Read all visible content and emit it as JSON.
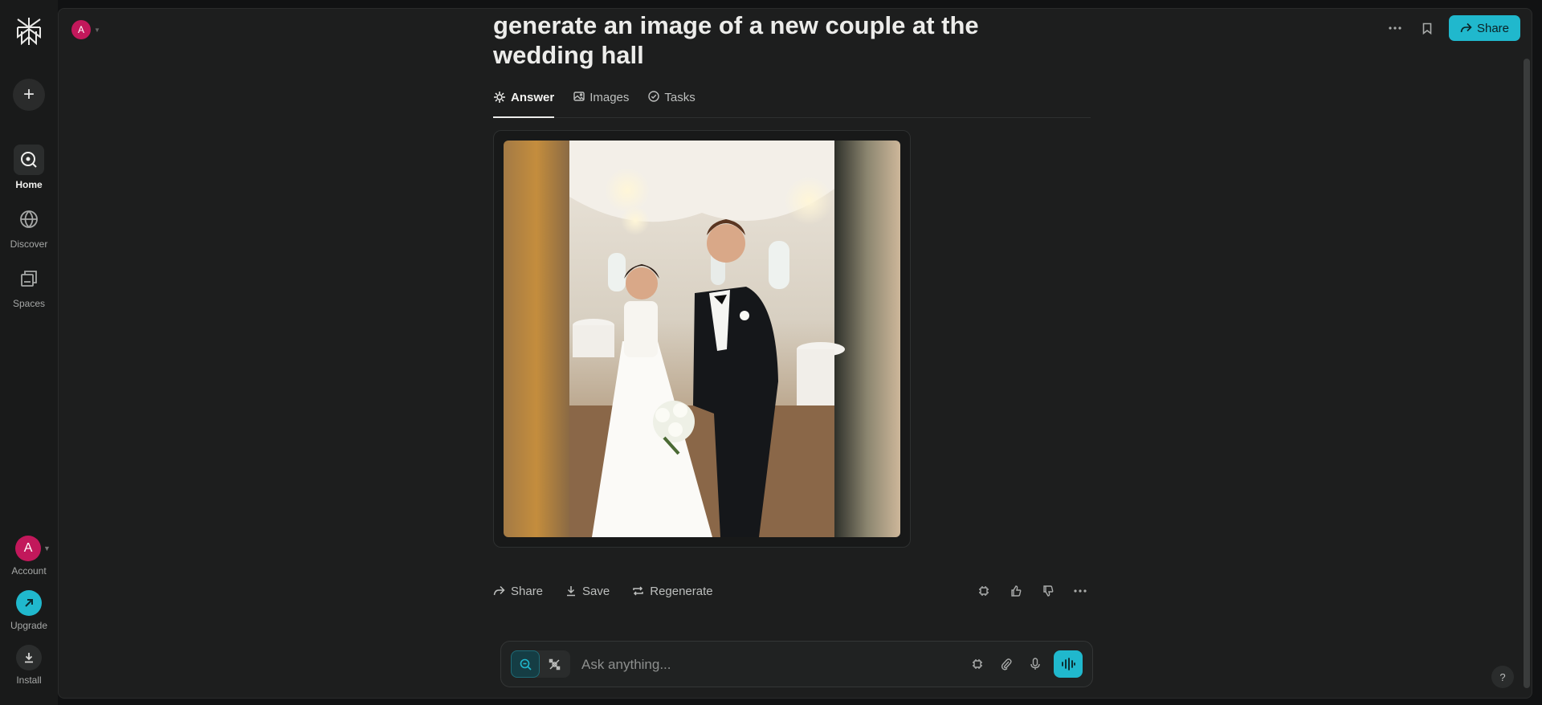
{
  "colors": {
    "accent": "#20b8cd",
    "avatar": "#c2185b"
  },
  "sidebar": {
    "avatar_letter": "A",
    "items": [
      {
        "label": "Home",
        "icon": "search-circle-icon",
        "active": true
      },
      {
        "label": "Discover",
        "icon": "globe-icon",
        "active": false
      },
      {
        "label": "Spaces",
        "icon": "spaces-icon",
        "active": false
      }
    ],
    "account_label": "Account",
    "upgrade_label": "Upgrade",
    "install_label": "Install"
  },
  "header": {
    "avatar_letter": "A",
    "share_label": "Share"
  },
  "thread": {
    "title": "generate an image of a new couple at the wedding hall",
    "tabs": [
      {
        "label": "Answer",
        "icon": "answer-icon",
        "active": true
      },
      {
        "label": "Images",
        "icon": "image-icon",
        "active": false
      },
      {
        "label": "Tasks",
        "icon": "check-circle-icon",
        "active": false
      }
    ],
    "actions": {
      "share": "Share",
      "save": "Save",
      "regenerate": "Regenerate"
    }
  },
  "ask": {
    "placeholder": "Ask anything..."
  },
  "help_label": "?"
}
